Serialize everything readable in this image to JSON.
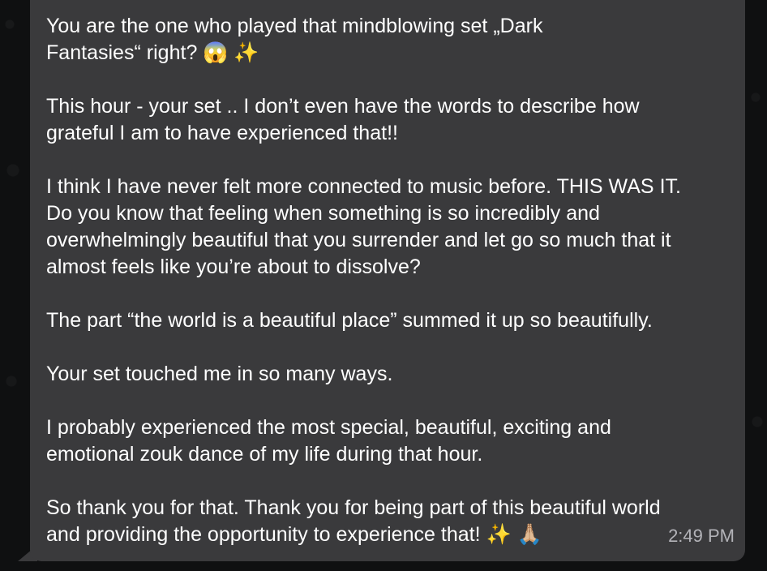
{
  "message": {
    "text": "You are the one who played that mindblowing set „Dark\nFantasies“ right? 😱 ✨\n\nThis hour - your set .. I don’t even have the words to describe how\ngrateful I am to have experienced that!!\n\nI think I have never felt more connected to music before. THIS WAS IT.\nDo you know that feeling when something is so incredibly and\noverwhelmingly beautiful that you surrender and let go so much that it\nalmost feels like you’re about to dissolve?\n\nThe part “the world is a beautiful place” summed it up so beautifully.\n\nYour set touched me in so many ways.\n\nI probably experienced the most special, beautiful, exciting and\nemotional zouk dance of my life during that hour.\n\nSo thank you for that. Thank you for being part of this beautiful world\nand providing the opportunity to experience that! ✨ 🙏🏼",
    "timestamp": "2:49 PM"
  },
  "colors": {
    "chat_background": "#0f1011",
    "bubble": "#3a3a3c",
    "text": "#ffffff",
    "timestamp": "#b3b3b8"
  }
}
